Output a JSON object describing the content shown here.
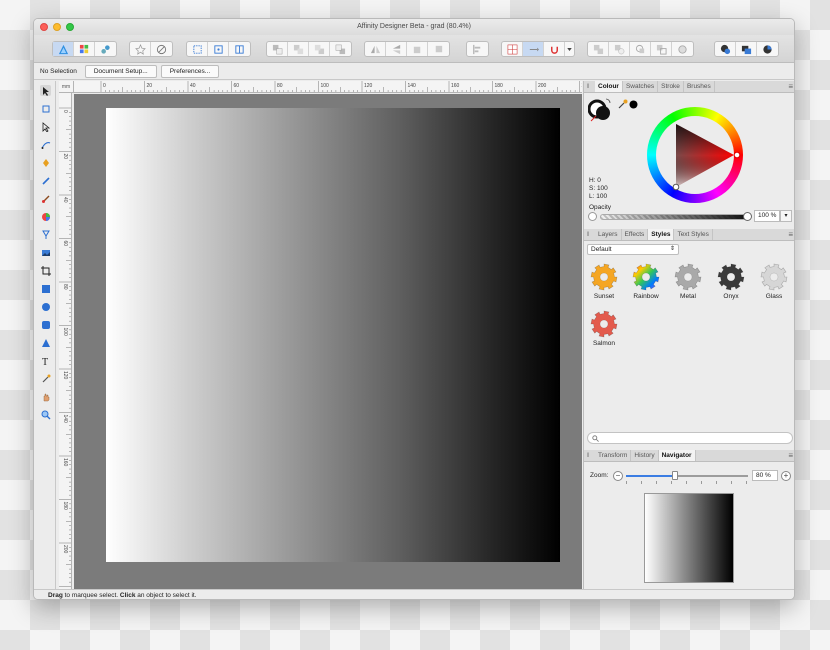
{
  "window": {
    "title": "Affinity Designer Beta - grad (80.4%)"
  },
  "context_bar": {
    "selection": "No Selection",
    "document_setup": "Document Setup...",
    "preferences": "Preferences..."
  },
  "rulers": {
    "unit": "mm",
    "top_labels": [
      "0",
      "20",
      "40",
      "60",
      "80",
      "100",
      "120",
      "140",
      "160",
      "180",
      "200",
      "22"
    ],
    "left_labels": [
      "0",
      "20",
      "40",
      "60",
      "80",
      "100",
      "120",
      "140",
      "160",
      "180",
      "200",
      "220"
    ]
  },
  "status_bar": {
    "drag": "Drag",
    "drag_text": " to marquee select. ",
    "click": "Click",
    "click_text": " an object to select it."
  },
  "colour_panel": {
    "tabs": [
      "Colour",
      "Swatches",
      "Stroke",
      "Brushes"
    ],
    "active_tab": "Colour",
    "h": "H: 0",
    "s": "S: 100",
    "l": "L: 100",
    "opacity_label": "Opacity",
    "opacity_value": "100 %",
    "opacity_fraction": 1.0,
    "hue_color": "#ff0000"
  },
  "styles_panel": {
    "tabs": [
      "Layers",
      "Effects",
      "Styles",
      "Text Styles"
    ],
    "active_tab": "Styles",
    "category": "Default",
    "items": [
      {
        "label": "Sunset",
        "color": "#f5a623",
        "icon": "gear-sunset-icon"
      },
      {
        "label": "Rainbow",
        "color": "#4b6cf0",
        "icon": "gear-rainbow-icon"
      },
      {
        "label": "Metal",
        "color": "#a9a9a9",
        "icon": "gear-metal-icon"
      },
      {
        "label": "Onyx",
        "color": "#3a3a3a",
        "icon": "gear-onyx-icon"
      },
      {
        "label": "Glass",
        "color": "#d6d6d6",
        "icon": "gear-glass-icon"
      },
      {
        "label": "Salmon",
        "color": "#e35b4d",
        "icon": "gear-salmon-icon"
      }
    ]
  },
  "navigator_panel": {
    "tabs": [
      "Transform",
      "History",
      "Navigator"
    ],
    "active_tab": "Navigator",
    "zoom_label": "Zoom:",
    "zoom_value": "80 %",
    "zoom_fraction": 0.4
  },
  "colors": {
    "accent": "#3b7de3",
    "canvas_background": "#7b7b7b",
    "gradient_start": "#ffffff",
    "gradient_end": "#000000"
  }
}
